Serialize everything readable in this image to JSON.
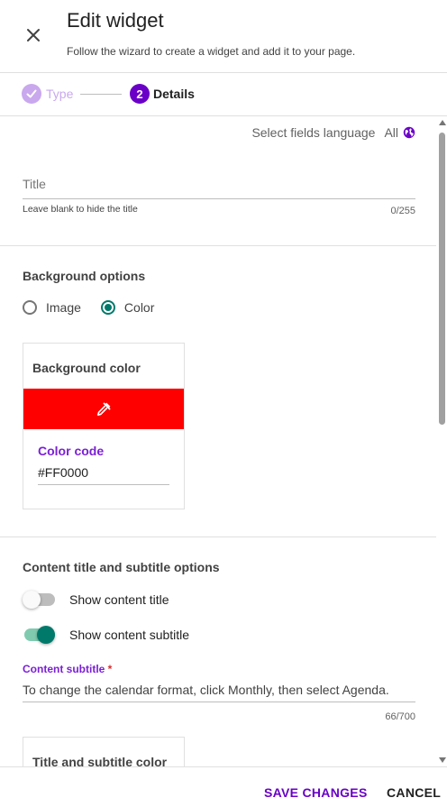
{
  "header": {
    "title": "Edit widget",
    "subtitle": "Follow the wizard to create a widget and add it to your page.",
    "close_icon": "close-icon"
  },
  "stepper": {
    "steps": [
      {
        "label": "Type",
        "state": "completed",
        "icon": "check-icon"
      },
      {
        "label": "Details",
        "number": "2",
        "state": "active"
      }
    ]
  },
  "language": {
    "label": "Select fields language",
    "value": "All",
    "icon": "globe-icon"
  },
  "title_field": {
    "label": "Title",
    "value": "",
    "help": "Leave blank to hide the title",
    "counter": "0/255"
  },
  "background": {
    "heading": "Background options",
    "options": [
      {
        "label": "Image",
        "checked": false
      },
      {
        "label": "Color",
        "checked": true
      }
    ],
    "card": {
      "title": "Background color",
      "swatch_color": "#FF0000",
      "swatch_icon": "eyedropper-icon",
      "code_label": "Color code",
      "code_value": "#FF0000"
    }
  },
  "content_options": {
    "heading": "Content title and subtitle options",
    "toggles": [
      {
        "label": "Show content title",
        "on": false
      },
      {
        "label": "Show content subtitle",
        "on": true
      }
    ],
    "subtitle_field": {
      "label": "Content subtitle",
      "required_mark": "*",
      "value": "To change the calendar format, click Monthly, then select Agenda.",
      "counter": "66/700"
    },
    "color_card_title": "Title and subtitle color"
  },
  "footer": {
    "save_label": "SAVE CHANGES",
    "cancel_label": "CANCEL"
  },
  "colors": {
    "accent": "#6a00c7",
    "teal": "#00796b",
    "swatch": "#FF0000"
  }
}
